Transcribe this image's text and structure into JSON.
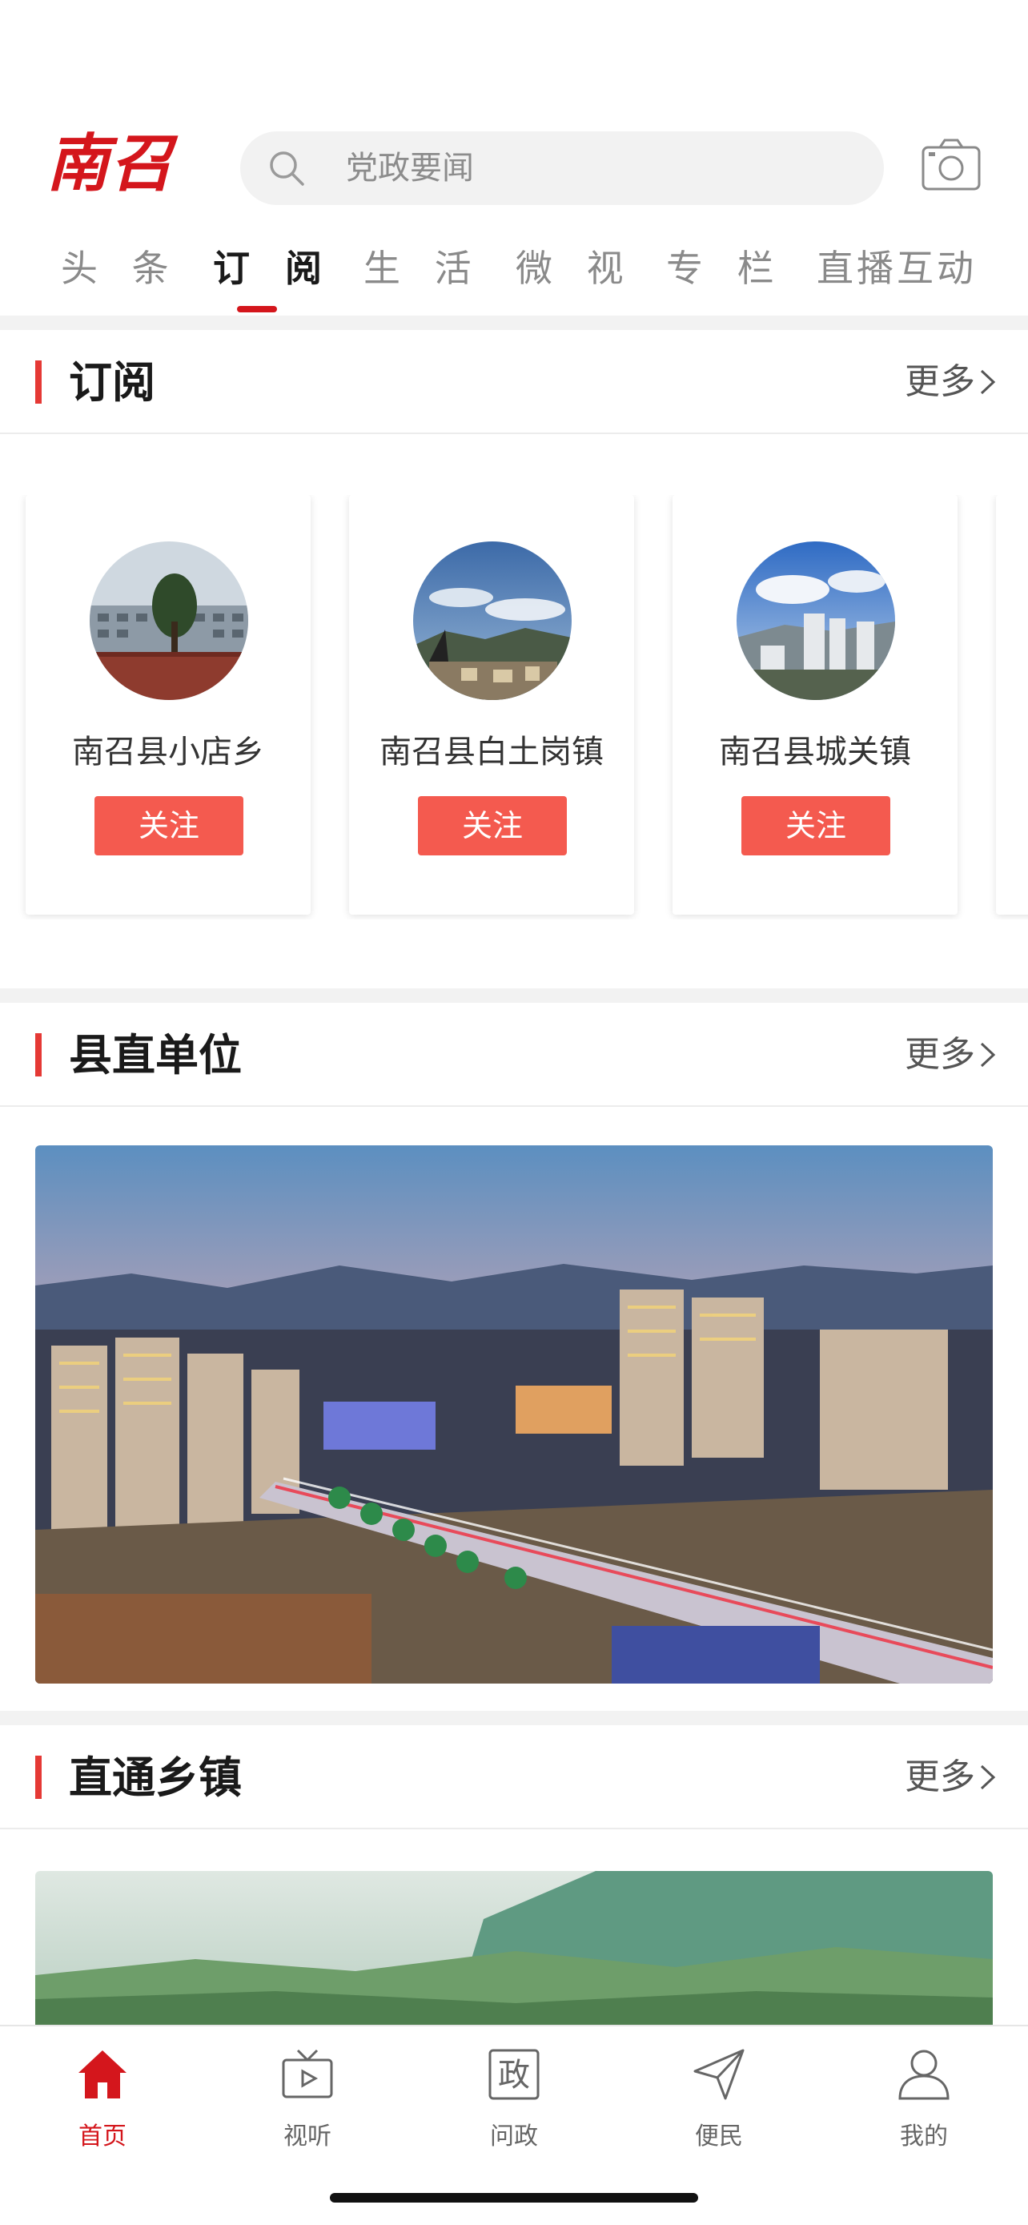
{
  "header": {
    "logo_text": "南召",
    "search_placeholder": "党政要闻"
  },
  "tabs": [
    {
      "label": "头 条"
    },
    {
      "label": "订 阅"
    },
    {
      "label": "生 活"
    },
    {
      "label": "微 视"
    },
    {
      "label": "专 栏"
    },
    {
      "label": "直播互动"
    }
  ],
  "active_tab": "订 阅",
  "subscribe_section": {
    "title": "订阅",
    "more": "更多",
    "cards": [
      {
        "name": "南召县小店乡",
        "button": "关注"
      },
      {
        "name": "南召县白土岗镇",
        "button": "关注"
      },
      {
        "name": "南召县城关镇",
        "button": "关注"
      }
    ]
  },
  "county_section": {
    "title": "县直单位",
    "more": "更多"
  },
  "town_section": {
    "title": "直通乡镇",
    "more": "更多"
  },
  "tabbar": [
    {
      "label": "首页",
      "icon": "home-icon"
    },
    {
      "label": "视听",
      "icon": "tv-icon"
    },
    {
      "label": "问政",
      "icon": "zheng-icon"
    },
    {
      "label": "便民",
      "icon": "send-icon"
    },
    {
      "label": "我的",
      "icon": "user-icon"
    }
  ],
  "colors": {
    "brand_red": "#d4161c",
    "accent_bar": "#e53935",
    "follow_button": "#f45a4f"
  }
}
